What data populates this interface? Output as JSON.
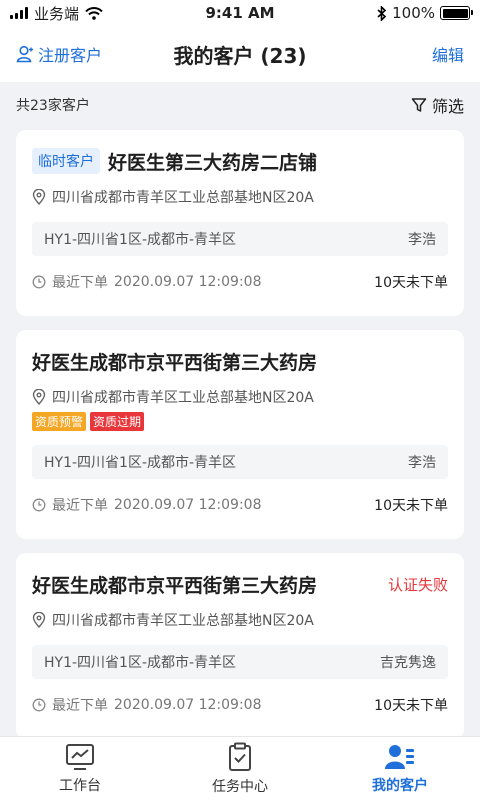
{
  "status_bar": {
    "carrier": "业务端",
    "time": "9:41 AM",
    "battery_pct": "100%",
    "battery_level": 1.0
  },
  "nav": {
    "left_label": "注册客户",
    "title": "我的客户 (23)",
    "right_label": "编辑"
  },
  "summary": {
    "total_text": "共23家客户",
    "filter_label": "筛选"
  },
  "customers": [
    {
      "tag": "临时客户",
      "name": "好医生第三大药房二店铺",
      "address": "四川省成都市青羊区工业总部基地N区20A",
      "region": "HY1-四川省1区-成都市-青羊区",
      "rep": "李浩",
      "last_order_label": "最近下单",
      "last_order_time": "2020.09.07 12:09:08",
      "order_status": "10天未下单"
    },
    {
      "name": "好医生成都市京平西街第三大药房",
      "address": "四川省成都市青羊区工业总部基地N区20A",
      "badges": [
        "资质预警",
        "资质过期"
      ],
      "region": "HY1-四川省1区-成都市-青羊区",
      "rep": "李浩",
      "last_order_label": "最近下单",
      "last_order_time": "2020.09.07 12:09:08",
      "order_status": "10天未下单"
    },
    {
      "name": "好医生成都市京平西街第三大药房",
      "status": "认证失败",
      "address": "四川省成都市青羊区工业总部基地N区20A",
      "region": "HY1-四川省1区-成都市-青羊区",
      "rep": "吉克隽逸",
      "last_order_label": "最近下单",
      "last_order_time": "2020.09.07 12:09:08",
      "order_status": "10天未下单"
    }
  ],
  "tabs": [
    {
      "label": "工作台",
      "icon": "dashboard-icon",
      "active": false
    },
    {
      "label": "任务中心",
      "icon": "clipboard-icon",
      "active": false
    },
    {
      "label": "我的客户",
      "icon": "customers-icon",
      "active": true
    }
  ],
  "colors": {
    "accent": "#1e6fd9",
    "danger": "#e8363b",
    "warning": "#f5a623",
    "background": "#f0f2f5"
  }
}
